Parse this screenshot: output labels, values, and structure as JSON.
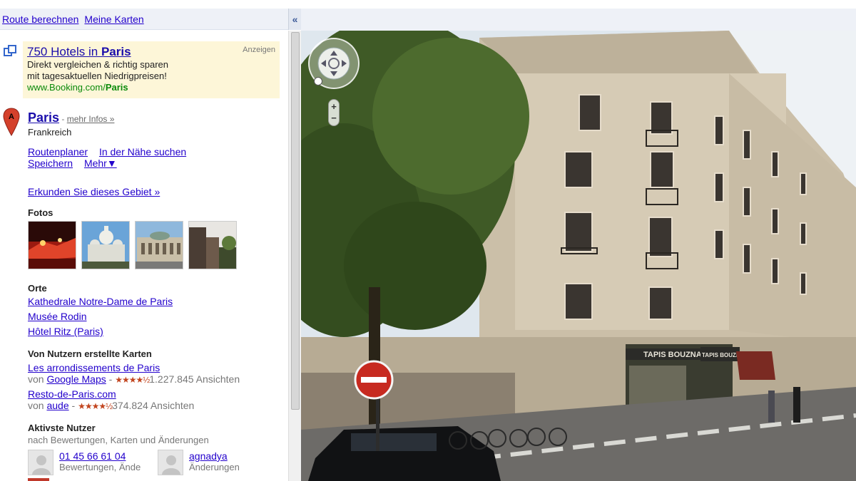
{
  "topbar": {
    "route": "Route berechnen",
    "maps": "Meine Karten",
    "collapse": "«"
  },
  "ad": {
    "title_prefix": "750 Hotels in ",
    "title_bold": "Paris",
    "line1": "Direkt vergleichen & richtig sparen",
    "line2": "mit tagesaktuellen Niedrigpreisen!",
    "url_prefix": "www.Booking.com/",
    "url_bold": "Paris",
    "tag": "Anzeigen"
  },
  "place": {
    "marker": "A",
    "name": "Paris",
    "dash": " - ",
    "more": "mehr Infos »",
    "country": "Frankreich",
    "actions": [
      "Routenplaner",
      "In der Nähe suchen",
      "Speichern",
      "Mehr▼"
    ],
    "explore": "Erkunden Sie dieses Gebiet »"
  },
  "photos": {
    "title": "Fotos"
  },
  "orte": {
    "title": "Orte",
    "items": [
      "Kathedrale Notre-Dame de Paris",
      "Musée Rodin",
      "Hôtel Ritz (Paris)"
    ]
  },
  "user_maps": {
    "title": "Von Nutzern erstellte Karten",
    "items": [
      {
        "name": "Les arrondissements de Paris",
        "by": "von ",
        "author": "Google Maps",
        "views": "1.227.845 Ansichten",
        "stars": "★★★★½"
      },
      {
        "name": "Resto-de-Paris.com",
        "by": "von ",
        "author": "aude",
        "views": "374.824 Ansichten",
        "stars": "★★★★½"
      }
    ]
  },
  "active_users": {
    "title": "Aktivste Nutzer",
    "subtitle": "nach Bewertungen, Karten und Änderungen",
    "users": [
      {
        "name": "01 45 66 61 04",
        "desc": "Bewertungen, Ände"
      },
      {
        "name": "agnadya",
        "desc": "Änderungen"
      }
    ]
  },
  "streetview": {
    "shop_sign": "TAPIS BOUZNAH",
    "shop_sign2": "TAPIS BOUZNAH"
  },
  "colors": {
    "link": "#2200cc",
    "ad_bg": "#fdf6d8",
    "ad_url": "#0a8a0a",
    "marker": "#d4402b"
  }
}
